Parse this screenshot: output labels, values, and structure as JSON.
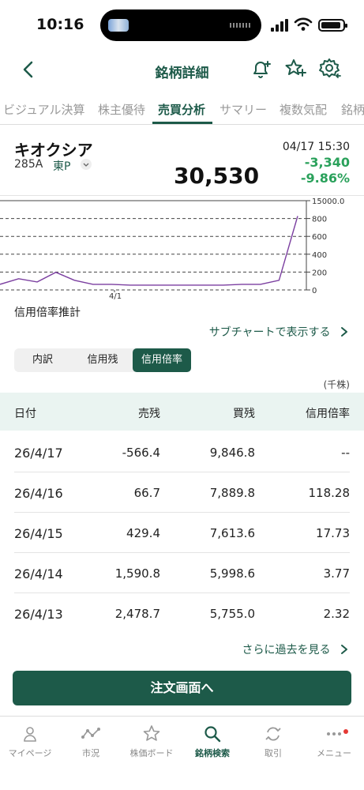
{
  "status": {
    "time": "10:16"
  },
  "nav": {
    "title": "銘柄詳細"
  },
  "tabs": [
    {
      "label": "ビジュアル決算"
    },
    {
      "label": "株主優待"
    },
    {
      "label": "売買分析"
    },
    {
      "label": "サマリー"
    },
    {
      "label": "複数気配"
    },
    {
      "label": "銘柄"
    }
  ],
  "stock": {
    "name": "キオクシア",
    "code": "285A",
    "market": "東P",
    "datetime": "04/17 15:30",
    "price": "30,530",
    "change": "-3,340",
    "change_pct": "-9.86%"
  },
  "chart_data": {
    "type": "line",
    "y_ticks": [
      "15000.0",
      "800",
      "600",
      "400",
      "200",
      "0"
    ],
    "x_label": "4/1",
    "series": [
      {
        "values": [
          0.05,
          0.12,
          0.08,
          0.2,
          0.1,
          0.05,
          0.05,
          0.04,
          0.04,
          0.04,
          0.04,
          0.04,
          0.04,
          0.05,
          0.05,
          0.1,
          0.9
        ]
      }
    ]
  },
  "section": {
    "label": "信用倍率推計",
    "subchart_link": "サブチャートで表示する"
  },
  "segments": [
    {
      "label": "内訳"
    },
    {
      "label": "信用残"
    },
    {
      "label": "信用倍率"
    }
  ],
  "table": {
    "unit": "(千株)",
    "headers": {
      "date": "日付",
      "sell": "売残",
      "buy": "買残",
      "ratio": "信用倍率"
    },
    "rows": [
      {
        "date": "26/4/17",
        "sell": "-566.4",
        "buy": "9,846.8",
        "ratio": "--"
      },
      {
        "date": "26/4/16",
        "sell": "66.7",
        "buy": "7,889.8",
        "ratio": "118.28"
      },
      {
        "date": "26/4/15",
        "sell": "429.4",
        "buy": "7,613.6",
        "ratio": "17.73"
      },
      {
        "date": "26/4/14",
        "sell": "1,590.8",
        "buy": "5,998.6",
        "ratio": "3.77"
      },
      {
        "date": "26/4/13",
        "sell": "2,478.7",
        "buy": "5,755.0",
        "ratio": "2.32"
      }
    ],
    "more_link": "さらに過去を見る"
  },
  "order_button": "注文画面へ",
  "bottom_nav": [
    {
      "label": "マイページ"
    },
    {
      "label": "市況"
    },
    {
      "label": "株価ボード"
    },
    {
      "label": "銘柄検索"
    },
    {
      "label": "取引"
    },
    {
      "label": "メニュー"
    }
  ]
}
